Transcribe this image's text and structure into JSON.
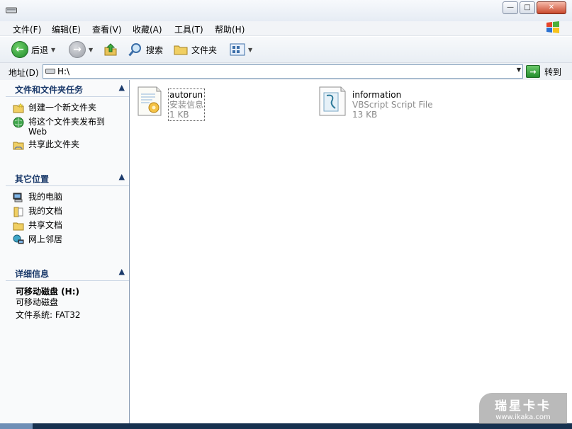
{
  "window": {
    "buttons": {
      "minimize": "—",
      "maximize": "□",
      "close": "✕"
    }
  },
  "menu": [
    {
      "label": "文件(F)"
    },
    {
      "label": "编辑(E)"
    },
    {
      "label": "查看(V)"
    },
    {
      "label": "收藏(A)"
    },
    {
      "label": "工具(T)"
    },
    {
      "label": "帮助(H)"
    }
  ],
  "toolbar": {
    "back_label": "后退",
    "search_label": "搜索",
    "folders_label": "文件夹"
  },
  "address": {
    "label": "地址(D)",
    "value": "H:\\",
    "go_label": "转到"
  },
  "taskpane": {
    "file_tasks": {
      "title": "文件和文件夹任务",
      "items": [
        {
          "label": "创建一个新文件夹",
          "icon": "new-folder-icon"
        },
        {
          "label": "将这个文件夹发布到 Web",
          "icon": "publish-web-icon"
        },
        {
          "label": "共享此文件夹",
          "icon": "share-folder-icon"
        }
      ]
    },
    "other_places": {
      "title": "其它位置",
      "items": [
        {
          "label": "我的电脑",
          "icon": "my-computer-icon"
        },
        {
          "label": "我的文档",
          "icon": "my-documents-icon"
        },
        {
          "label": "共享文档",
          "icon": "shared-documents-icon"
        },
        {
          "label": "网上邻居",
          "icon": "network-places-icon"
        }
      ]
    },
    "details": {
      "title": "详细信息",
      "name": "可移动磁盘 (H:)",
      "type": "可移动磁盘",
      "fs": "文件系统: FAT32"
    }
  },
  "files": [
    {
      "name": "autorun",
      "type": "安装信息",
      "size": "1 KB",
      "icon": "setup-info-file-icon"
    },
    {
      "name": "information",
      "type": "VBScript Script File",
      "size": "13 KB",
      "icon": "vbscript-file-icon"
    }
  ],
  "watermark": {
    "title": "瑞星卡卡",
    "url": "www.ikaka.com"
  },
  "colors": {
    "accent": "#1b3a6b",
    "go_green": "#248d2e"
  }
}
